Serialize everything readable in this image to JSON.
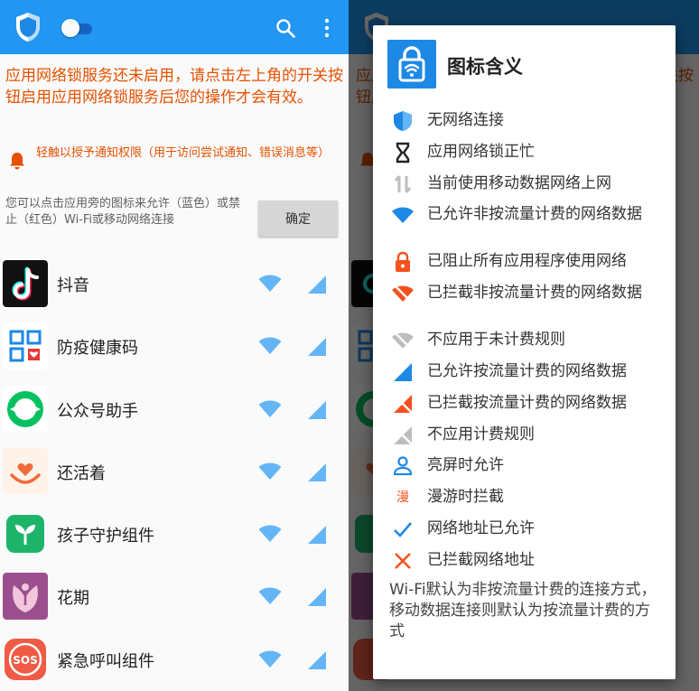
{
  "left": {
    "warning_text": "应用网络锁服务还未启用，请点击左上角的开关按钮启用应用网络锁服务后您的操作才会有效。",
    "notification_text": "轻触以授予通知权限（用于访问尝试通知、错误消息等）",
    "hint_text": "您可以点击应用旁的图标来允许（蓝色）或禁止（红色）Wi-Fi或移动网络连接",
    "ok_label": "确定",
    "apps": [
      {
        "name": "抖音",
        "icon": "douyin-icon"
      },
      {
        "name": "防疫健康码",
        "icon": "health-code-icon"
      },
      {
        "name": "公众号助手",
        "icon": "wechat-mp-icon"
      },
      {
        "name": "还活着",
        "icon": "alive-icon"
      },
      {
        "name": "孩子守护组件",
        "icon": "child-guard-icon"
      },
      {
        "name": "花期",
        "icon": "huaqi-icon"
      },
      {
        "name": "紧急呼叫组件",
        "icon": "sos-icon"
      }
    ]
  },
  "dialog": {
    "title": "图标含义",
    "items": [
      {
        "icon": "shield-icon",
        "label": "无网络连接"
      },
      {
        "icon": "hourglass-icon",
        "label": "应用网络锁正忙"
      },
      {
        "icon": "mobile-data-icon",
        "label": "当前使用移动数据网络上网"
      },
      {
        "icon": "wifi-allowed-icon",
        "label": "已允许非按流量计费的网络数据"
      },
      {
        "icon": "lock-icon",
        "label": "已阻止所有应用程序使用网络"
      },
      {
        "icon": "wifi-blocked-icon",
        "label": "已拦截非按流量计费的网络数据"
      },
      {
        "icon": "wifi-off-icon",
        "label": "不应用于未计费规则"
      },
      {
        "icon": "cellular-allowed-icon",
        "label": "已允许按流量计费的网络数据"
      },
      {
        "icon": "cellular-blocked-icon",
        "label": "已拦截按流量计费的网络数据"
      },
      {
        "icon": "cellular-off-icon",
        "label": "不应用计费规则"
      },
      {
        "icon": "person-icon",
        "label": "亮屏时允许"
      },
      {
        "icon": "roaming-icon",
        "label": "漫游时拦截",
        "glyph": "漫"
      },
      {
        "icon": "check-icon",
        "label": "网络地址已允许"
      },
      {
        "icon": "cross-icon",
        "label": "已拦截网络地址"
      }
    ],
    "footer": "Wi-Fi默认为非按流量计费的连接方式，移动数据连接则默认为按流量计费的方式"
  },
  "apps_icon_text": {
    "sos": "SOS"
  },
  "colors": {
    "primary": "#2196f3",
    "warning": "#e65100",
    "allowed": "#2196f3",
    "blocked": "#f4511e",
    "disabled": "#bdbdbd"
  }
}
